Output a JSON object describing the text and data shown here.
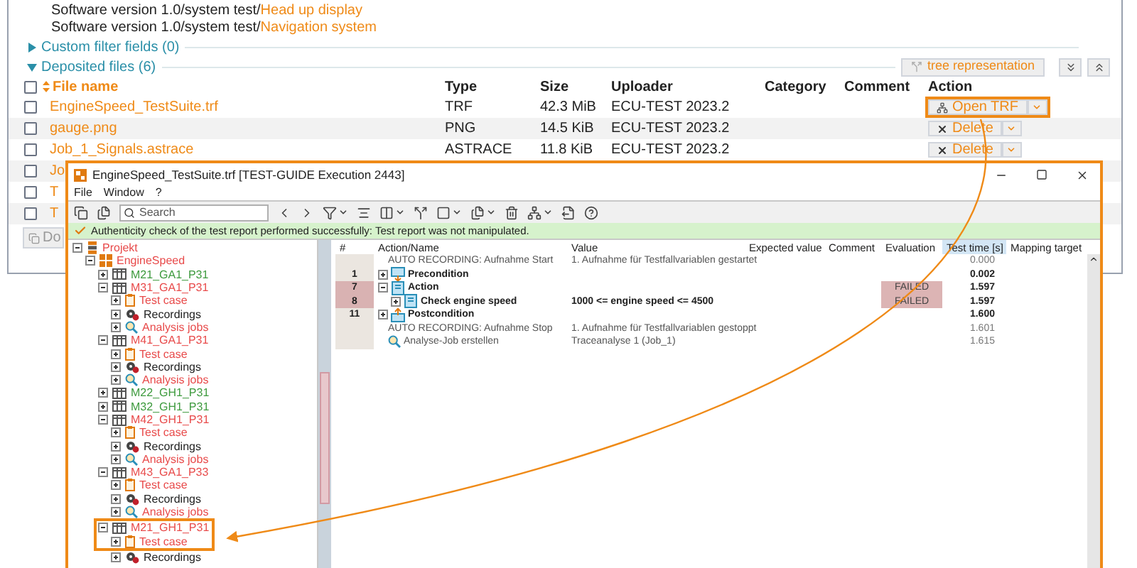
{
  "versions": [
    {
      "path": "Software version 1.0/system test/",
      "link": "Head up display"
    },
    {
      "path": "Software version 1.0/system test/",
      "link": "Navigation system"
    }
  ],
  "custom_filter_fields": {
    "label": "Custom filter fields (0)",
    "expanded": false
  },
  "deposited_files": {
    "label": "Deposited files (6)",
    "expanded": true,
    "tree_button": "tree representation",
    "select_all_checked": false,
    "columns": [
      "File name",
      "Type",
      "Size",
      "Uploader",
      "Category",
      "Comment",
      "Action"
    ],
    "rows": [
      {
        "checked": false,
        "name": "EngineSpeed_TestSuite.trf",
        "type": "TRF",
        "size": "42.3 MiB",
        "uploader": "ECU-TEST 2023.2",
        "action": {
          "kind": "open",
          "label": "Open TRF",
          "highlighted": true
        }
      },
      {
        "checked": false,
        "name": "gauge.png",
        "type": "PNG",
        "size": "14.5 KiB",
        "uploader": "ECU-TEST 2023.2",
        "action": {
          "kind": "delete",
          "label": "Delete",
          "highlighted": false
        }
      },
      {
        "checked": false,
        "name": "Job_1_Signals.astrace",
        "type": "ASTRACE",
        "size": "11.8 KiB",
        "uploader": "ECU-TEST 2023.2",
        "action": {
          "kind": "delete",
          "label": "Delete",
          "highlighted": false
        }
      },
      {
        "checked": false,
        "name": "Jo"
      },
      {
        "checked": false,
        "name": "T"
      },
      {
        "checked": false,
        "name": "T"
      }
    ],
    "download_button": "Do"
  },
  "window": {
    "title": "EngineSpeed_TestSuite.trf [TEST-GUIDE Execution 2443]",
    "menu": [
      "File",
      "Window",
      "?"
    ],
    "search": {
      "placeholder": "Search"
    },
    "banner": "Authenticity check of the test report performed successfully: Test report was not manipulated.",
    "tree": [
      {
        "label": "Projekt",
        "kind": "project",
        "color": "#e84a4a",
        "expanded": true,
        "children": [
          {
            "label": "EngineSpeed",
            "kind": "package",
            "color": "#e84a4a",
            "expanded": true,
            "children": [
              {
                "label": "M21_GA1_P31",
                "kind": "group",
                "color": "#3d9a3d",
                "expanded": false
              },
              {
                "label": "M31_GA1_P31",
                "kind": "group",
                "color": "#e84a4a",
                "expanded": true,
                "children": [
                  {
                    "label": "Test case",
                    "kind": "testcase",
                    "color": "#e84a4a",
                    "expanded": false
                  },
                  {
                    "label": "Recordings",
                    "kind": "recordings",
                    "color": "#222222",
                    "expanded": false
                  },
                  {
                    "label": "Analysis jobs",
                    "kind": "analysis",
                    "color": "#e84a4a",
                    "expanded": false
                  }
                ]
              },
              {
                "label": "M41_GA1_P31",
                "kind": "group",
                "color": "#e84a4a",
                "expanded": true,
                "children": [
                  {
                    "label": "Test case",
                    "kind": "testcase",
                    "color": "#e84a4a",
                    "expanded": false
                  },
                  {
                    "label": "Recordings",
                    "kind": "recordings",
                    "color": "#222222",
                    "expanded": false
                  },
                  {
                    "label": "Analysis jobs",
                    "kind": "analysis",
                    "color": "#e84a4a",
                    "expanded": false
                  }
                ]
              },
              {
                "label": "M22_GH1_P31",
                "kind": "group",
                "color": "#3d9a3d",
                "expanded": false
              },
              {
                "label": "M32_GH1_P31",
                "kind": "group",
                "color": "#3d9a3d",
                "expanded": false
              },
              {
                "label": "M42_GH1_P31",
                "kind": "group",
                "color": "#e84a4a",
                "expanded": true,
                "children": [
                  {
                    "label": "Test case",
                    "kind": "testcase",
                    "color": "#e84a4a",
                    "expanded": false
                  },
                  {
                    "label": "Recordings",
                    "kind": "recordings",
                    "color": "#222222",
                    "expanded": false
                  },
                  {
                    "label": "Analysis jobs",
                    "kind": "analysis",
                    "color": "#e84a4a",
                    "expanded": false
                  }
                ]
              },
              {
                "label": "M43_GA1_P33",
                "kind": "group",
                "color": "#e84a4a",
                "expanded": true,
                "children": [
                  {
                    "label": "Test case",
                    "kind": "testcase",
                    "color": "#e84a4a",
                    "expanded": false
                  },
                  {
                    "label": "Recordings",
                    "kind": "recordings",
                    "color": "#222222",
                    "expanded": false
                  },
                  {
                    "label": "Analysis jobs",
                    "kind": "analysis",
                    "color": "#e84a4a",
                    "expanded": false
                  }
                ]
              },
              {
                "label": "M21_GH1_P31",
                "kind": "group",
                "color": "#e84a4a",
                "expanded": true,
                "highlighted": true,
                "children": [
                  {
                    "label": "Test case",
                    "kind": "testcase",
                    "color": "#e84a4a",
                    "expanded": false
                  },
                  {
                    "label": "Recordings",
                    "kind": "recordings",
                    "color": "#222222",
                    "expanded": false
                  }
                ]
              }
            ]
          }
        ]
      }
    ],
    "columns": [
      {
        "label": "#",
        "selected": false
      },
      {
        "label": "Action/Name",
        "selected": false
      },
      {
        "label": "Value",
        "selected": false
      },
      {
        "label": "Expected value",
        "selected": false
      },
      {
        "label": "Comment",
        "selected": false
      },
      {
        "label": "Evaluation",
        "selected": false
      },
      {
        "label": "Test time [s]",
        "selected": true
      },
      {
        "label": "Mapping target",
        "selected": false
      }
    ],
    "rows": [
      {
        "kind": "log",
        "name": "AUTO RECORDING: Aufnahme Start",
        "value": "1. Aufnahme für Testfallvariablen gestartet",
        "time": "0.000"
      },
      {
        "kind": "precondition",
        "number": "1",
        "name": "Precondition",
        "expanded": false,
        "time": "0.002"
      },
      {
        "kind": "action",
        "number": "7",
        "name": "Action",
        "expanded": true,
        "evaluation": "FAILED",
        "time": "1.597",
        "children": [
          {
            "kind": "action",
            "number": "8",
            "name": "Check engine speed",
            "expanded": false,
            "value": "1000 <= engine speed <= 4500",
            "evaluation": "FAILED",
            "time": "1.597"
          }
        ]
      },
      {
        "kind": "postcondition",
        "number": "11",
        "name": "Postcondition",
        "expanded": false,
        "time": "1.600"
      },
      {
        "kind": "log",
        "name": "AUTO RECORDING: Aufnahme Stop",
        "value": "1. Aufnahme für Testfallvariablen gestoppt",
        "time": "1.601"
      },
      {
        "kind": "analysis",
        "name": "Analyse-Job erstellen",
        "value": "Traceanalyse 1 (Job_1)",
        "time": "1.615"
      }
    ]
  }
}
